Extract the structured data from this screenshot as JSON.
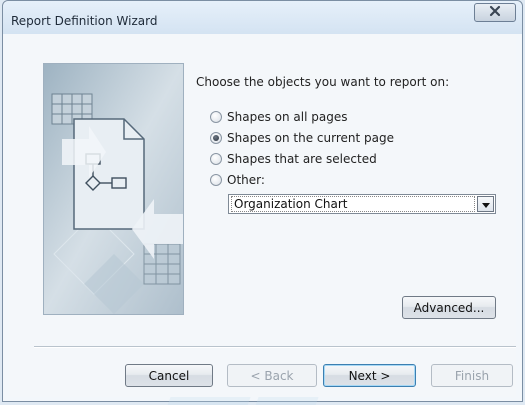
{
  "window": {
    "title": "Report Definition Wizard"
  },
  "prompt": "Choose the objects you want to report on:",
  "options": [
    {
      "label": "Shapes on all pages",
      "selected": false
    },
    {
      "label": "Shapes on the current page",
      "selected": true
    },
    {
      "label": "Shapes that are selected",
      "selected": false
    },
    {
      "label": "Other:",
      "selected": false
    }
  ],
  "other_dropdown": {
    "value": "Organization Chart"
  },
  "buttons": {
    "advanced": "Advanced...",
    "cancel": "Cancel",
    "back": "< Back",
    "next": "Next >",
    "finish": "Finish"
  },
  "icons": {
    "close": "close-icon",
    "dropdown": "chevron-down-icon",
    "wizard_art": "report-wizard-illustration"
  },
  "colors": {
    "accent_default_button": "#3c7fb1",
    "window_frame": "#7b8ea3"
  }
}
